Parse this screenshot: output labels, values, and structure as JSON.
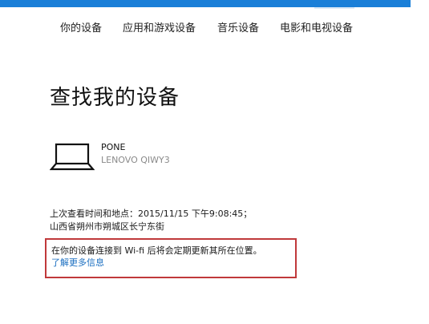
{
  "nav": {
    "items": [
      {
        "label": "你的设备"
      },
      {
        "label": "应用和游戏设备"
      },
      {
        "label": "音乐设备"
      },
      {
        "label": "电影和电视设备"
      }
    ]
  },
  "page": {
    "title": "查找我的设备"
  },
  "device": {
    "icon": "laptop-icon",
    "name": "PONE",
    "model": "LENOVO QIWY3"
  },
  "last_seen": {
    "text": "上次查看时间和地点：2015/11/15 下午9:08:45；山西省朔州市朔城区长宁东街"
  },
  "info": {
    "message": "在你的设备连接到 Wi-fi 后将会定期更新其所在位置。",
    "link_label": "了解更多信息",
    "highlight_color": "#c0393b"
  },
  "colors": {
    "accent": "#1a7fd8",
    "link": "#1a6ec0"
  }
}
